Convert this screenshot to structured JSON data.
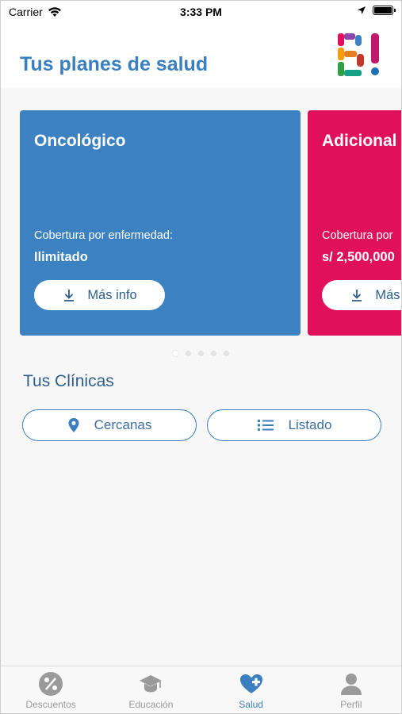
{
  "status_bar": {
    "carrier": "Carrier",
    "time": "3:33 PM"
  },
  "header": {
    "title": "Tus planes de salud",
    "logo_icon": "brand-logo-b"
  },
  "plans": [
    {
      "title": "Oncológico",
      "coverage_label": "Cobertura por enfermedad:",
      "coverage_value": "Ilimitado",
      "button_label": "Más info",
      "color": "#3c82c3"
    },
    {
      "title": "Adicional",
      "coverage_label": "Cobertura por",
      "coverage_value": "s/ 2,500,000",
      "button_label": "Más info",
      "color": "#e0105a"
    }
  ],
  "carousel": {
    "page_count": 5,
    "active_index": 0
  },
  "clinics": {
    "title": "Tus Clínicas",
    "near_label": "Cercanas",
    "list_label": "Listado"
  },
  "tab_bar": [
    {
      "label": "Descuentos",
      "icon": "percent-icon",
      "active": false
    },
    {
      "label": "Educación",
      "icon": "graduation-cap-icon",
      "active": false
    },
    {
      "label": "Salud",
      "icon": "heart-plus-icon",
      "active": true
    },
    {
      "label": "Perfil",
      "icon": "user-icon",
      "active": false
    }
  ],
  "colors": {
    "primary": "#3a7fbf",
    "pink": "#e0105a",
    "inactive": "#9a9a9a"
  }
}
